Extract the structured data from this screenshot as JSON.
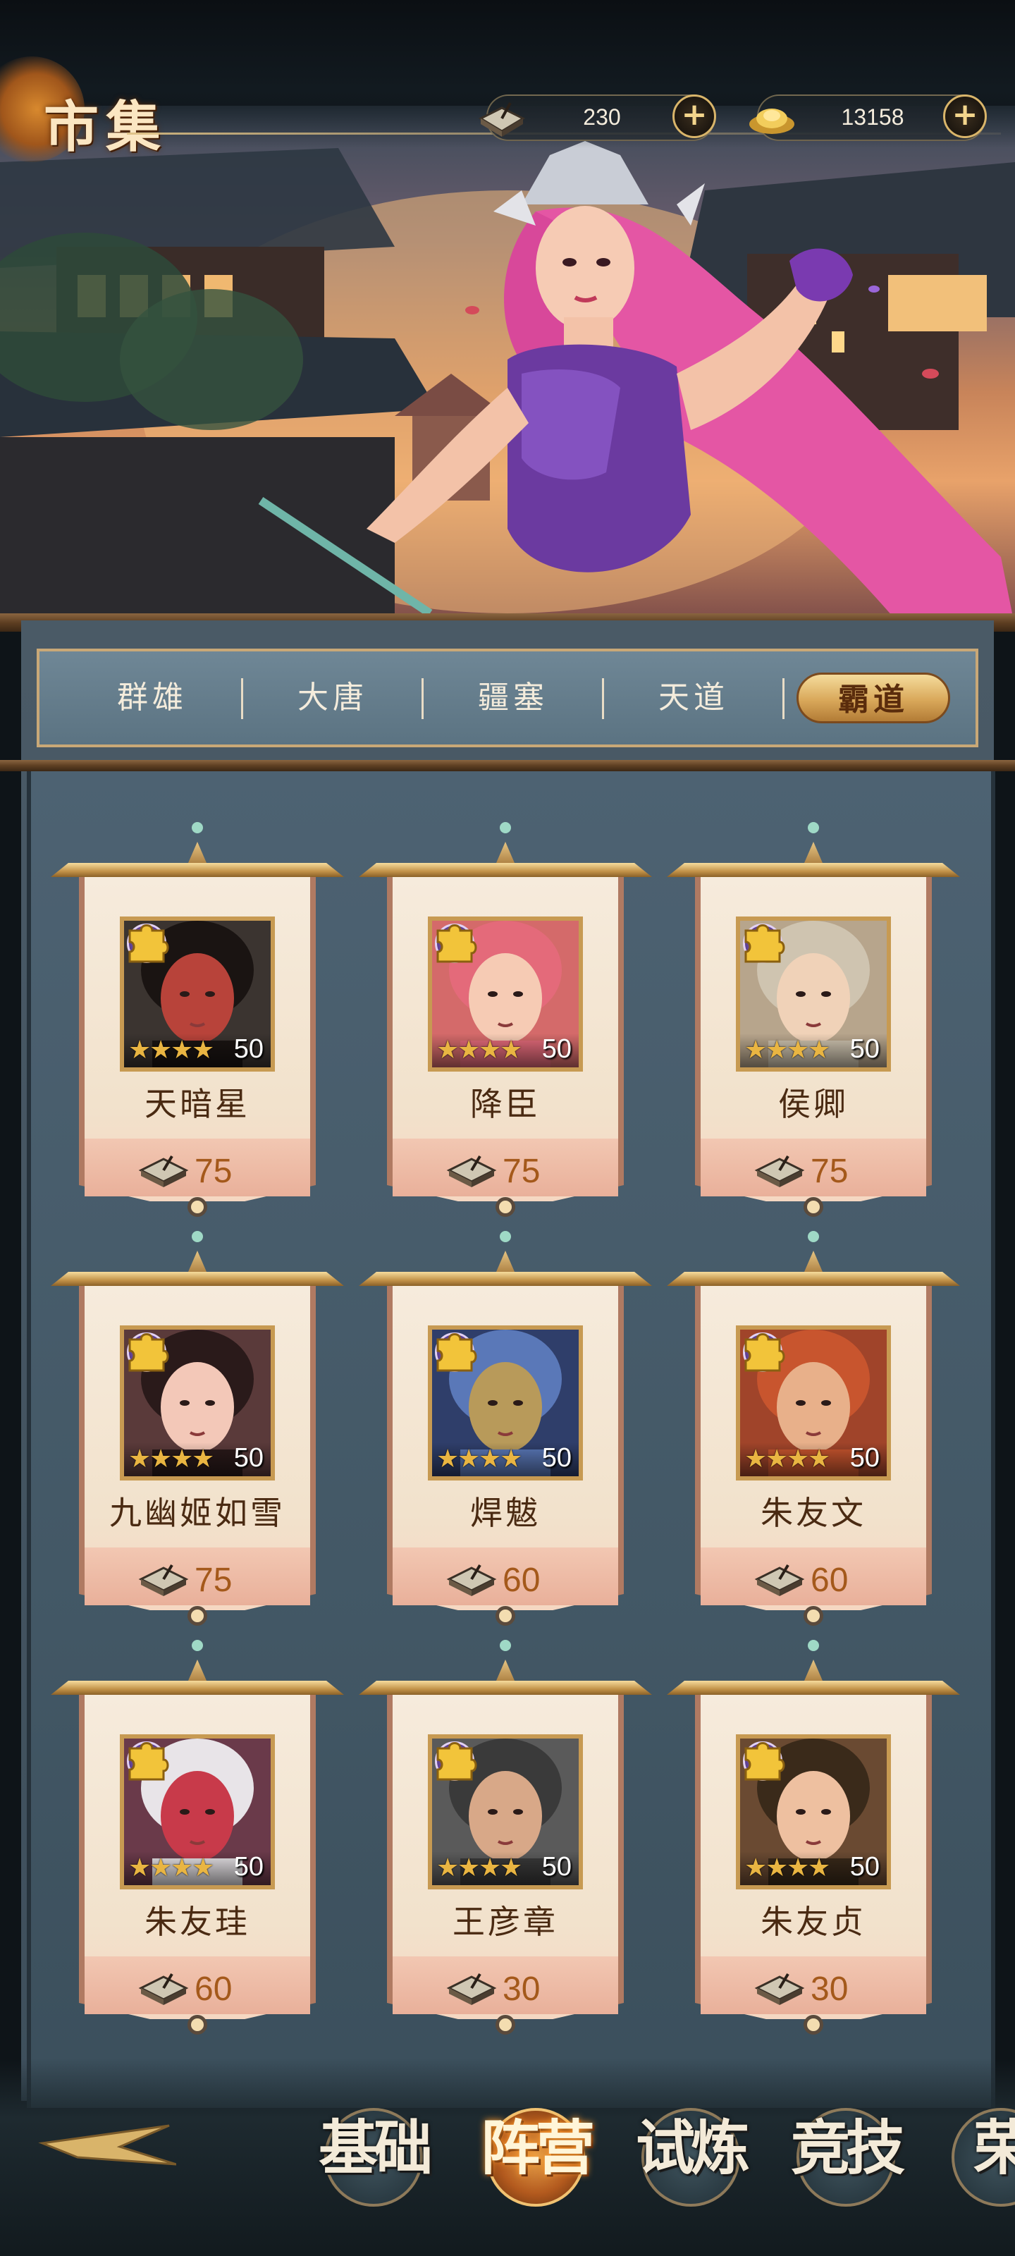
{
  "header": {
    "title": "市集",
    "currencies": [
      {
        "icon": "token-book-icon",
        "value": "230"
      },
      {
        "icon": "gold-ingot-icon",
        "value": "13158"
      }
    ]
  },
  "tabs": [
    {
      "label": "群雄",
      "active": false
    },
    {
      "label": "大唐",
      "active": false
    },
    {
      "label": "疆塞",
      "active": false
    },
    {
      "label": "天道",
      "active": false
    },
    {
      "label": "霸道",
      "active": true
    }
  ],
  "faction_badge": "霸",
  "heroes": [
    {
      "name": "天暗星",
      "level": "50",
      "stars": 4,
      "price": "75",
      "portrait": "masked-warrior-straw-hat"
    },
    {
      "name": "降臣",
      "level": "50",
      "stars": 4,
      "price": "75",
      "portrait": "red-haired-woman"
    },
    {
      "name": "侯卿",
      "level": "50",
      "stars": 4,
      "price": "75",
      "portrait": "silver-haired-man"
    },
    {
      "name": "九幽姬如雪",
      "level": "50",
      "stars": 4,
      "price": "75",
      "portrait": "dark-haired-woman"
    },
    {
      "name": "焊魃",
      "level": "50",
      "stars": 4,
      "price": "60",
      "portrait": "blue-demon-mask"
    },
    {
      "name": "朱友文",
      "level": "50",
      "stars": 4,
      "price": "60",
      "portrait": "red-haired-man"
    },
    {
      "name": "朱友珪",
      "level": "50",
      "stars": 4,
      "price": "60",
      "portrait": "white-masked-figure"
    },
    {
      "name": "王彦章",
      "level": "50",
      "stars": 4,
      "price": "30",
      "portrait": "bearded-warrior-headband"
    },
    {
      "name": "朱友贞",
      "level": "50",
      "stars": 4,
      "price": "30",
      "portrait": "young-noble-man"
    }
  ],
  "bottom_nav": [
    {
      "label": "基础",
      "active": false
    },
    {
      "label": "阵营",
      "active": true
    },
    {
      "label": "试炼",
      "active": false
    },
    {
      "label": "竞技",
      "active": false
    },
    {
      "label": "荣",
      "active": false
    }
  ],
  "colors": {
    "price_text": "#a4591b",
    "active_tab": "#d9a85a",
    "faction_purple": "#5c3d90",
    "star_gold": "#e9b542"
  }
}
